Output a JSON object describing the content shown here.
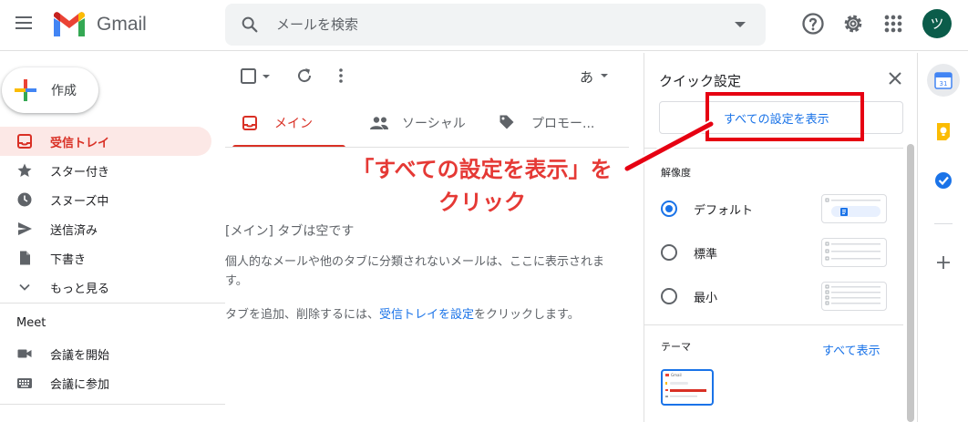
{
  "header": {
    "app_name": "Gmail",
    "search_placeholder": "メールを検索",
    "avatar_initial": "ツ"
  },
  "sidebar": {
    "compose_label": "作成",
    "items": [
      {
        "label": "受信トレイ",
        "active": true
      },
      {
        "label": "スター付き"
      },
      {
        "label": "スヌーズ中"
      },
      {
        "label": "送信済み"
      },
      {
        "label": "下書き"
      },
      {
        "label": "もっと見る"
      }
    ],
    "meet_title": "Meet",
    "meet_items": [
      {
        "label": "会議を開始"
      },
      {
        "label": "会議に参加"
      }
    ]
  },
  "toolbar": {
    "input_tool_label": "あ"
  },
  "tabs": [
    {
      "label": "メイン",
      "active": true
    },
    {
      "label": "ソーシャル"
    },
    {
      "label": "プロモー..."
    }
  ],
  "empty_state": {
    "title": "[メイン] タブは空です",
    "description": "個人的なメールや他のタブに分類されないメールは、ここに表示されます。",
    "hint_prefix": "タブを追加、削除するには、",
    "hint_link": "受信トレイを設定",
    "hint_suffix": "をクリックします。"
  },
  "annotation": {
    "line1": "「すべての設定を表示」を",
    "line2": "クリック",
    "color": "#e60012"
  },
  "quick_settings": {
    "title": "クイック設定",
    "all_settings_label": "すべての設定を表示",
    "density_title": "解像度",
    "density_options": [
      {
        "label": "デフォルト",
        "checked": true
      },
      {
        "label": "標準"
      },
      {
        "label": "最小"
      }
    ],
    "theme_title": "テーマ",
    "theme_view_all": "すべて表示",
    "theme_thumb_label": "Gmail"
  },
  "colors": {
    "accent_red": "#d93025",
    "link_blue": "#1a73e8",
    "avatar_bg": "#0b5c4a"
  },
  "right_rail": {
    "calendar_day": "31"
  }
}
